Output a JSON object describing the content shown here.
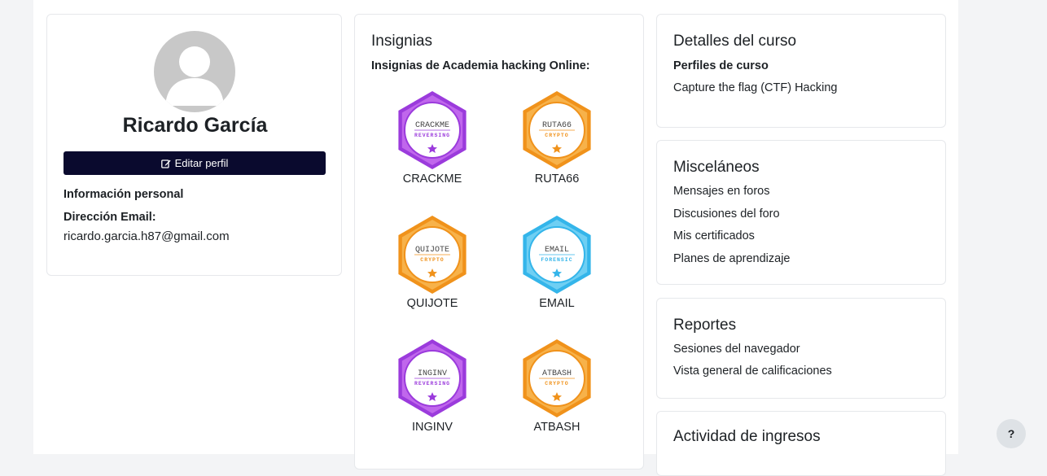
{
  "profile": {
    "name": "Ricardo García",
    "edit_label": "Editar perfil",
    "personal_info_heading": "Información personal",
    "email_label": "Dirección Email:",
    "email_value": "ricardo.garcia.h87@gmail.com"
  },
  "badges": {
    "title": "Insignias",
    "subtitle": "Insignias de Academia hacking Online:",
    "items": [
      {
        "name": "CRACKME",
        "logo": "CRACKME",
        "category": "REVERSING",
        "color": "#9b3bdc",
        "inner": "#c067ec"
      },
      {
        "name": "RUTA66",
        "logo": "RUTA66",
        "category": "CRYPTO",
        "color": "#f0921b",
        "inner": "#f7b24a"
      },
      {
        "name": "QUIJOTE",
        "logo": "QUIJOTE",
        "category": "CRYPTO",
        "color": "#f0921b",
        "inner": "#f7b24a"
      },
      {
        "name": "EMAIL",
        "logo": "EMAIL",
        "category": "FORENSIC",
        "color": "#34b5ea",
        "inner": "#6fcff3"
      },
      {
        "name": "INGINV",
        "logo": "INGINV",
        "category": "REVERSING",
        "color": "#9b3bdc",
        "inner": "#c067ec"
      },
      {
        "name": "ATBASH",
        "logo": "ATBASH",
        "category": "CRYPTO",
        "color": "#f0921b",
        "inner": "#f7b24a"
      }
    ]
  },
  "course_details": {
    "title": "Detalles del curso",
    "profiles_label": "Perfiles de curso",
    "course_link": "Capture the flag (CTF) Hacking"
  },
  "misc": {
    "title": "Misceláneos",
    "links": [
      "Mensajes en foros",
      "Discusiones del foro",
      "Mis certificados",
      "Planes de aprendizaje"
    ]
  },
  "reports": {
    "title": "Reportes",
    "links": [
      "Sesiones del navegador",
      "Vista general de calificaciones"
    ]
  },
  "activity": {
    "title": "Actividad de ingresos"
  },
  "help": {
    "label": "?"
  }
}
